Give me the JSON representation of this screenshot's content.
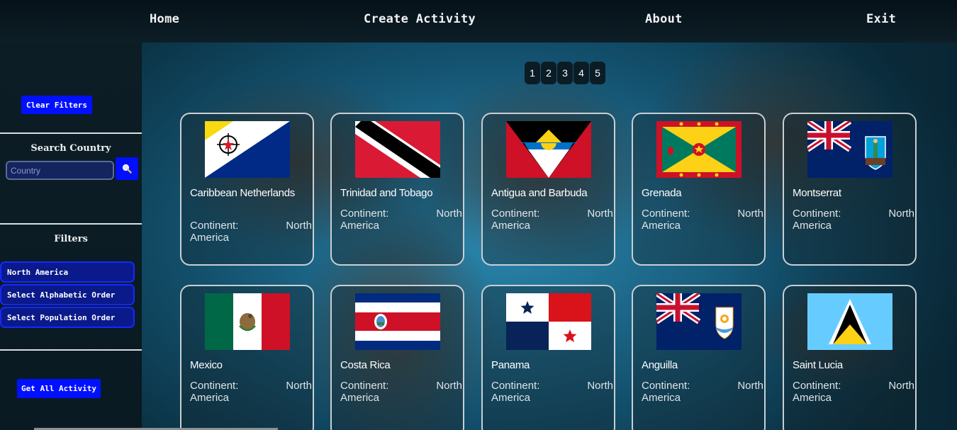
{
  "nav": {
    "home": "Home",
    "create_activity": "Create Activity",
    "about": "About",
    "exit": "Exit"
  },
  "sidebar": {
    "clear_filters": "Clear Filters",
    "search_title": "Search Country",
    "search_placeholder": "Country",
    "filters_title": "Filters",
    "filter_continent": "North America",
    "filter_alpha": "Select Alphabetic Order",
    "filter_population": "Select Population Order",
    "get_all_activity": "Get All Activity"
  },
  "pagination": [
    "1",
    "2",
    "3",
    "4",
    "5"
  ],
  "countries": [
    {
      "name": "Caribbean Netherlands",
      "continent_label": "Continent:",
      "continent_1": "North",
      "continent_2": "America",
      "flag": "bonaire-flag"
    },
    {
      "name": "Trinidad and Tobago",
      "continent_label": "Continent:",
      "continent_1": "North",
      "continent_2": "America",
      "flag": "trinidad-flag"
    },
    {
      "name": "Antigua and Barbuda",
      "continent_label": "Continent:",
      "continent_1": "North",
      "continent_2": "America",
      "flag": "antigua-flag"
    },
    {
      "name": "Grenada",
      "continent_label": "Continent:",
      "continent_1": "North",
      "continent_2": "America",
      "flag": "grenada-flag"
    },
    {
      "name": "Montserrat",
      "continent_label": "Continent:",
      "continent_1": "North",
      "continent_2": "America",
      "flag": "montserrat-flag"
    },
    {
      "name": "Mexico",
      "continent_label": "Continent:",
      "continent_1": "North",
      "continent_2": "America",
      "flag": "mexico-flag"
    },
    {
      "name": "Costa Rica",
      "continent_label": "Continent:",
      "continent_1": "North",
      "continent_2": "America",
      "flag": "costa-rica-flag"
    },
    {
      "name": "Panama",
      "continent_label": "Continent:",
      "continent_1": "North",
      "continent_2": "America",
      "flag": "panama-flag"
    },
    {
      "name": "Anguilla",
      "continent_label": "Continent:",
      "continent_1": "North",
      "continent_2": "America",
      "flag": "anguilla-flag"
    },
    {
      "name": "Saint Lucia",
      "continent_label": "Continent:",
      "continent_1": "North",
      "continent_2": "America",
      "flag": "saint-lucia-flag"
    }
  ],
  "colors": {
    "button_blue": "#0010ff",
    "card_border": "#c9cfd3",
    "ocean_blue": "#2b88b0"
  }
}
